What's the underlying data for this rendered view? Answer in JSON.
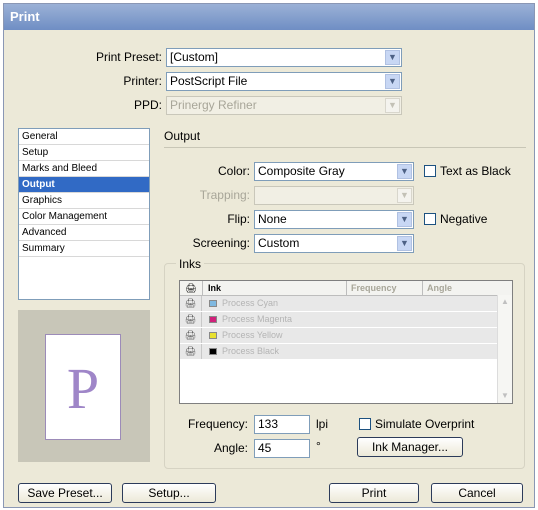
{
  "window": {
    "title": "Print"
  },
  "top": {
    "preset_label": "Print Preset:",
    "preset_value": "[Custom]",
    "printer_label": "Printer:",
    "printer_value": "PostScript File",
    "ppd_label": "PPD:",
    "ppd_value": "Prinergy Refiner"
  },
  "sidebar": {
    "items": [
      {
        "label": "General",
        "selected": false
      },
      {
        "label": "Setup",
        "selected": false
      },
      {
        "label": "Marks and Bleed",
        "selected": false
      },
      {
        "label": "Output",
        "selected": true
      },
      {
        "label": "Graphics",
        "selected": false
      },
      {
        "label": "Color Management",
        "selected": false
      },
      {
        "label": "Advanced",
        "selected": false
      },
      {
        "label": "Summary",
        "selected": false
      }
    ],
    "preview_letter": "P"
  },
  "output": {
    "section_title": "Output",
    "color_label": "Color:",
    "color_value": "Composite Gray",
    "text_as_black_label": "Text as Black",
    "text_as_black_checked": false,
    "trapping_label": "Trapping:",
    "trapping_value": "",
    "flip_label": "Flip:",
    "flip_value": "None",
    "negative_label": "Negative",
    "negative_checked": false,
    "screening_label": "Screening:",
    "screening_value": "Custom"
  },
  "inks": {
    "group_title": "Inks",
    "columns": [
      "Ink",
      "Frequency",
      "Angle"
    ],
    "rows": [
      {
        "name": "Process Cyan",
        "color": "#7fb8e0"
      },
      {
        "name": "Process Magenta",
        "color": "#d0207a"
      },
      {
        "name": "Process Yellow",
        "color": "#e8e030"
      },
      {
        "name": "Process Black",
        "color": "#000000"
      }
    ],
    "frequency_label": "Frequency:",
    "frequency_value": "133",
    "frequency_unit": "lpi",
    "angle_label": "Angle:",
    "angle_value": "45",
    "angle_unit": "°",
    "simulate_overprint_label": "Simulate Overprint",
    "simulate_overprint_checked": false,
    "ink_manager_label": "Ink Manager..."
  },
  "buttons": {
    "save_preset": "Save Preset...",
    "setup": "Setup...",
    "print": "Print",
    "cancel": "Cancel"
  }
}
